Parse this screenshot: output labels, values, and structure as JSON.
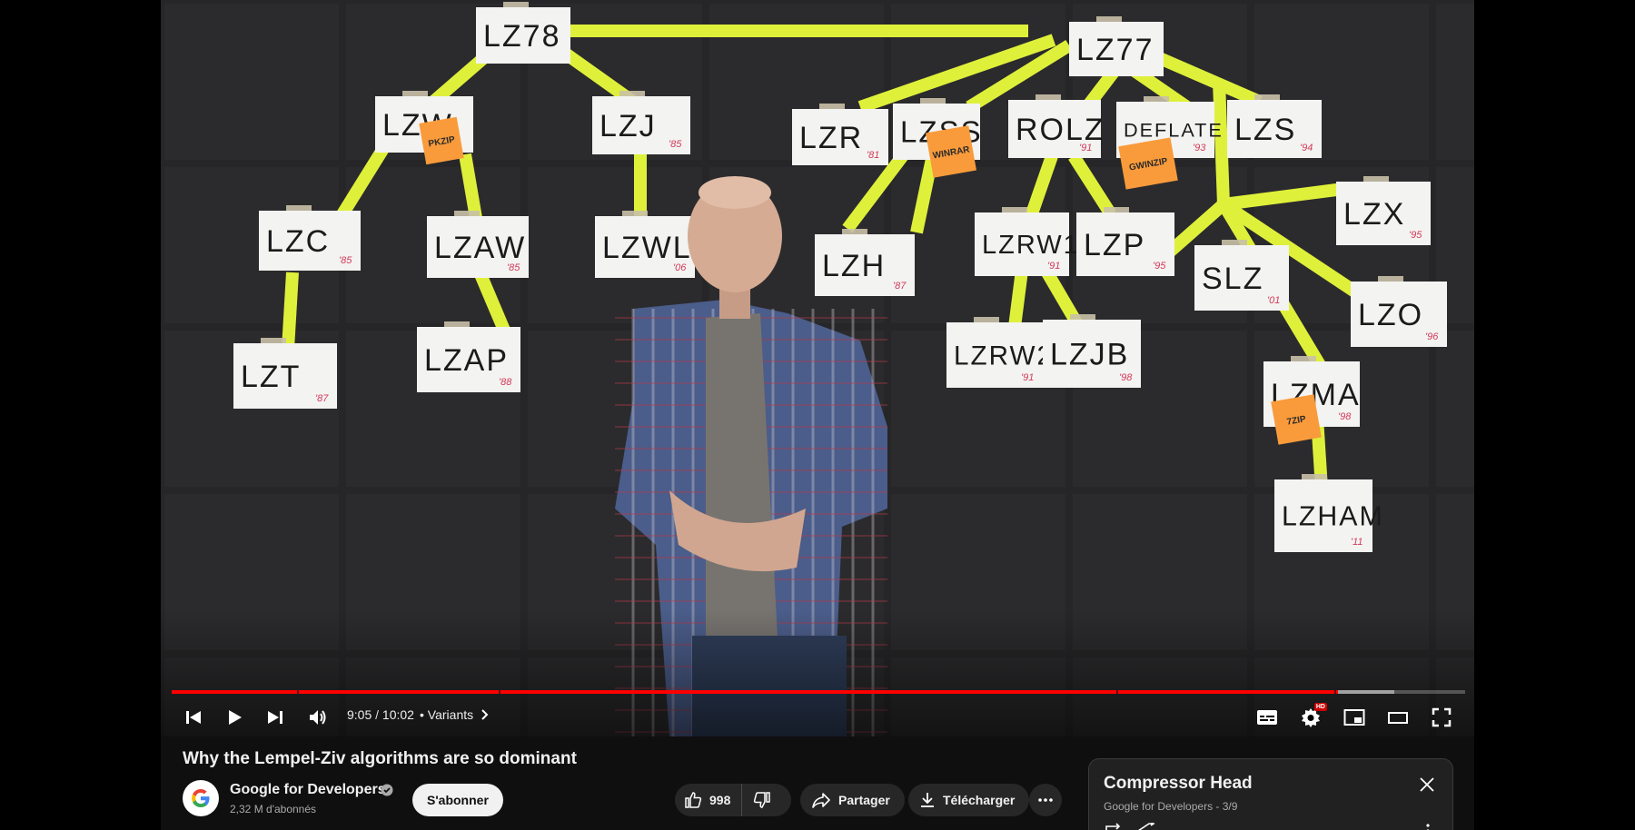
{
  "video": {
    "scene": {
      "notes": [
        {
          "label": "LZ78",
          "year": ""
        },
        {
          "label": "LZ77",
          "year": ""
        },
        {
          "label": "LZW",
          "year": ""
        },
        {
          "label": "LZJ",
          "year": "'85"
        },
        {
          "label": "LZR",
          "year": "'81"
        },
        {
          "label": "LZSS",
          "year": ""
        },
        {
          "label": "ROLZ",
          "year": "'91"
        },
        {
          "label": "DEFLATE",
          "year": "'93"
        },
        {
          "label": "LZS",
          "year": "'94"
        },
        {
          "label": "LZC",
          "year": "'85"
        },
        {
          "label": "LZAW",
          "year": "'85"
        },
        {
          "label": "LZWL",
          "year": "'06"
        },
        {
          "label": "LZH",
          "year": "'87"
        },
        {
          "label": "LZRW1",
          "year": "'91"
        },
        {
          "label": "LZP",
          "year": "'95"
        },
        {
          "label": "LZX",
          "year": "'95"
        },
        {
          "label": "SLZ",
          "year": "'01"
        },
        {
          "label": "LZO",
          "year": "'96"
        },
        {
          "label": "LZT",
          "year": "'87"
        },
        {
          "label": "LZAP",
          "year": "'88"
        },
        {
          "label": "LZRW2",
          "year": "'91"
        },
        {
          "label": "LZJB",
          "year": "'98"
        },
        {
          "label": "LZMA",
          "year": "'98"
        },
        {
          "label": "LZHAM",
          "year": "'11"
        }
      ],
      "tags": [
        "PKZIP",
        "WINRAR",
        "GWINZIP",
        "7ZIP"
      ]
    },
    "player": {
      "progress_fraction": 0.902,
      "buffered_fraction": 0.945,
      "current_time": "9:05",
      "separator": "/",
      "duration": "10:02",
      "chapter_label": "Variants",
      "chapter_bullet": "•",
      "hd_badge": "HD"
    }
  },
  "info": {
    "title": "Why the Lempel-Ziv algorithms are so dominant",
    "channel_name": "Google for Developers",
    "subscribers": "2,32 M d'abonnés",
    "subscribe_label": "S'abonner",
    "like_count": "998",
    "share_label": "Partager",
    "download_label": "Télécharger"
  },
  "playlist": {
    "title": "Compressor Head",
    "subtitle": "Google for Developers - 3/9"
  },
  "colors": {
    "accent_red": "#ff0000",
    "tape_yellow": "#dff03a",
    "tag_orange": "#f99b3b"
  }
}
